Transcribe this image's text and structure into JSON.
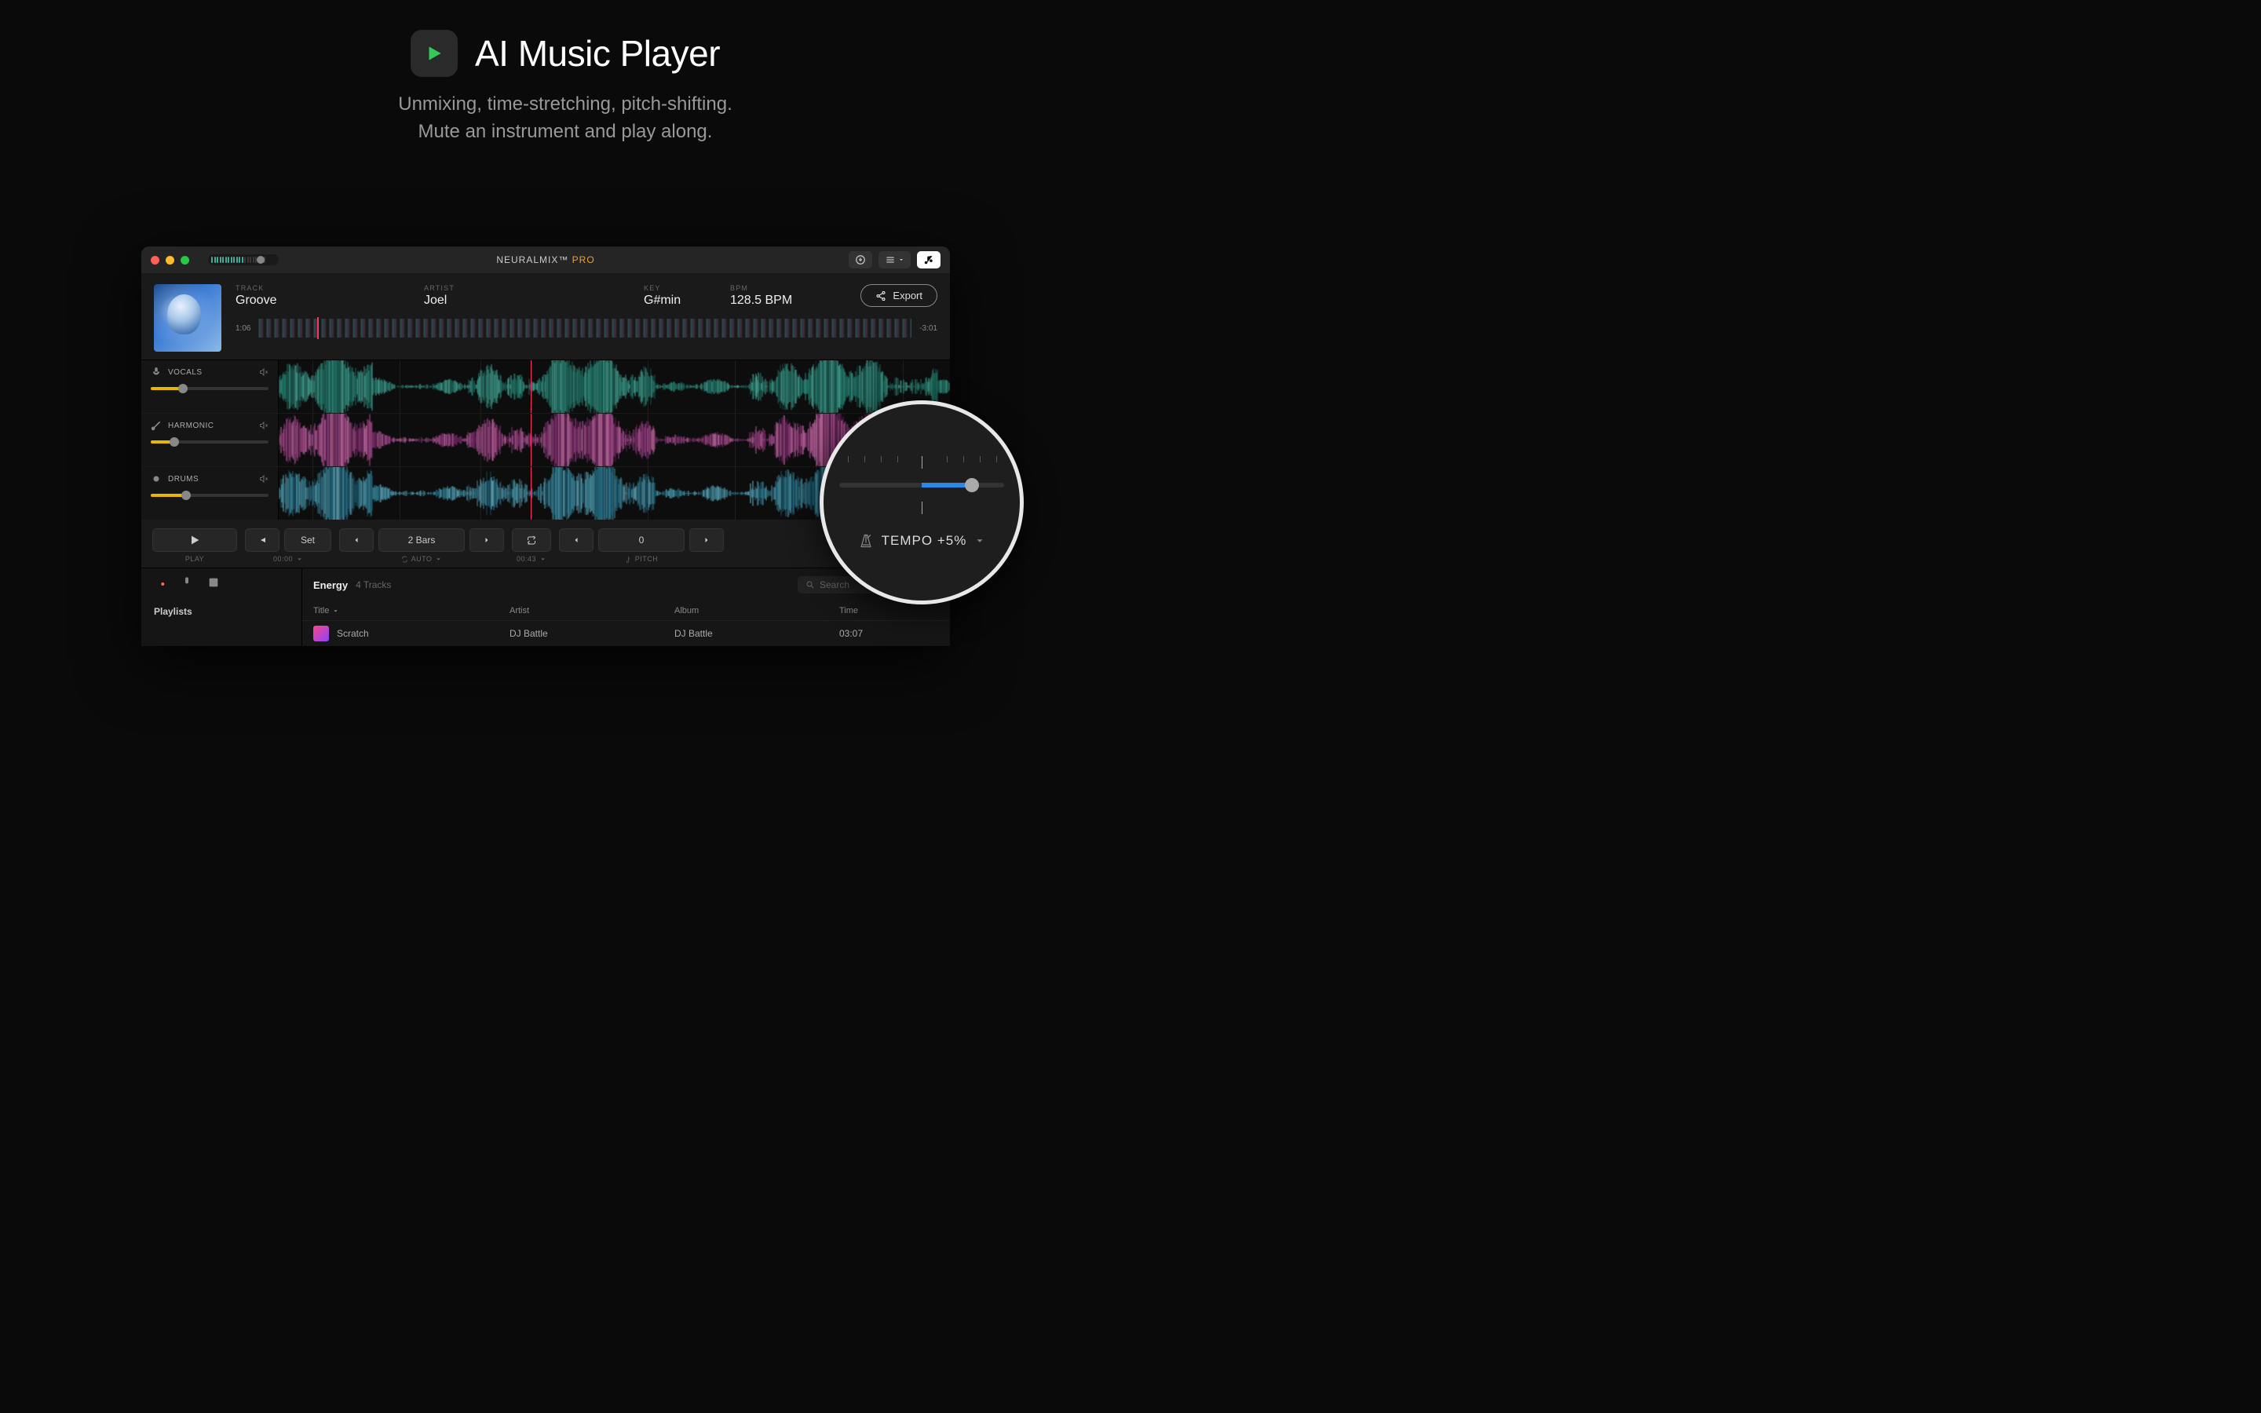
{
  "hero": {
    "title": "AI Music Player",
    "subtitle1": "Unmixing, time-stretching, pitch-shifting.",
    "subtitle2": "Mute an instrument and play along."
  },
  "titlebar": {
    "brand_main": "NEURALMIX™",
    "brand_suffix": " PRO"
  },
  "track": {
    "track_label": "TRACK",
    "track_name": "Groove",
    "artist_label": "ARTIST",
    "artist_name": "Joel",
    "key_label": "KEY",
    "key_value": "G#min",
    "bpm_label": "BPM",
    "bpm_value": "128.5 BPM",
    "export_label": "Export",
    "elapsed": "1:06",
    "remaining": "-3:01"
  },
  "stems": [
    {
      "name": "VOCALS",
      "fill": 25
    },
    {
      "name": "HARMONIC",
      "fill": 18
    },
    {
      "name": "DRUMS",
      "fill": 28
    }
  ],
  "transport": {
    "play_label": "PLAY",
    "set_label": "Set",
    "loop_time": "00:00",
    "bars_label": "2 Bars",
    "auto_label": "AUTO",
    "jump_time": "00:43",
    "pitch_value": "0",
    "pitch_label": "PITCH"
  },
  "browser": {
    "playlist_name": "Energy",
    "playlist_count": "4 Tracks",
    "search_placeholder": "Search",
    "sidebar_heading": "Playlists",
    "columns": {
      "title": "Title",
      "artist": "Artist",
      "album": "Album",
      "time": "Time"
    },
    "rows": [
      {
        "title": "Scratch",
        "artist": "DJ Battle",
        "album": "DJ Battle",
        "time": "03:07"
      }
    ]
  },
  "tempo": {
    "label": "TEMPO +5%"
  }
}
